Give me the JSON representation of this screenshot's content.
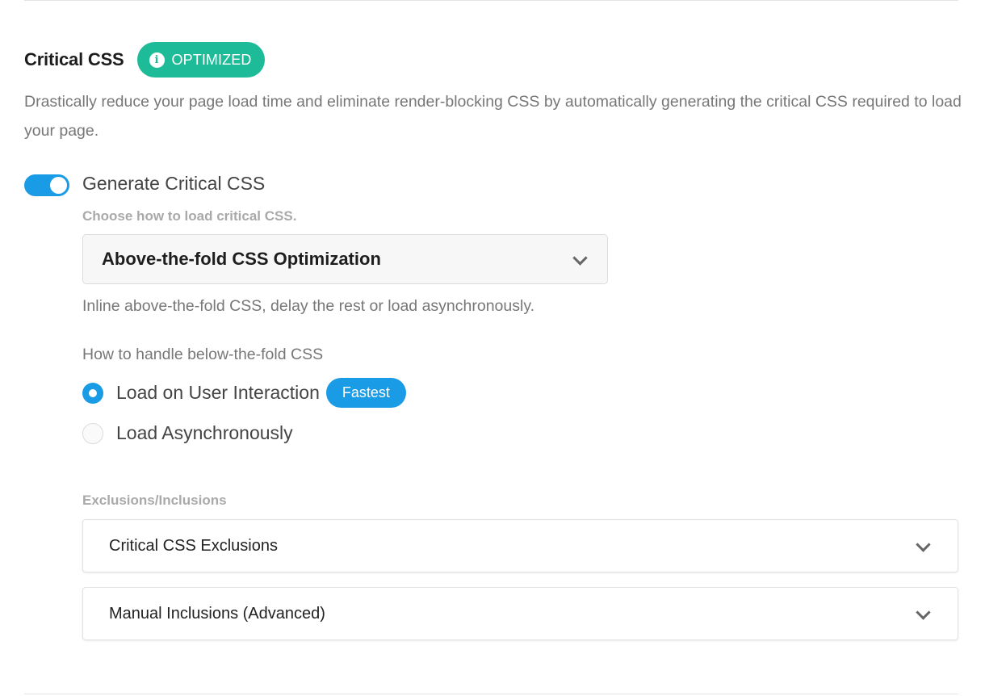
{
  "section": {
    "title": "Critical CSS",
    "status_badge": "OPTIMIZED",
    "status_icon": "info-icon",
    "description": "Drastically reduce your page load time and eliminate render-blocking CSS by automatically generating the critical CSS required to load your page."
  },
  "generate": {
    "label": "Generate Critical CSS",
    "enabled": true,
    "load_method_label": "Choose how to load critical CSS.",
    "load_method_value": "Above-the-fold CSS Optimization",
    "load_method_hint": "Inline above-the-fold CSS, delay the rest or load asynchronously."
  },
  "below_fold": {
    "label": "How to handle below-the-fold CSS",
    "options": [
      {
        "label": "Load on User Interaction",
        "selected": true,
        "tag": "Fastest"
      },
      {
        "label": "Load Asynchronously",
        "selected": false
      }
    ]
  },
  "exclusions": {
    "label": "Exclusions/Inclusions",
    "panels": [
      {
        "title": "Critical CSS Exclusions"
      },
      {
        "title": "Manual Inclusions (Advanced)"
      }
    ]
  },
  "colors": {
    "accent_blue": "#1a9be6",
    "badge_green": "#1dbb97"
  }
}
